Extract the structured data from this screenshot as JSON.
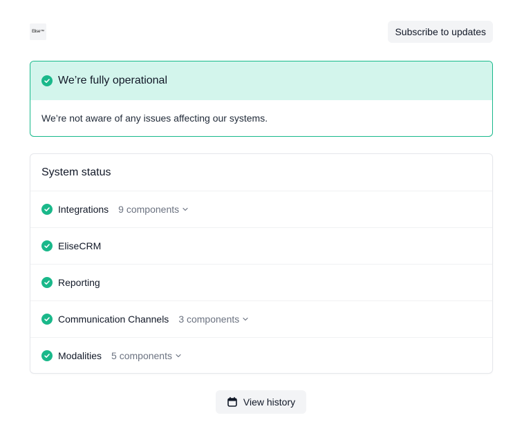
{
  "header": {
    "logo_text": "Elise™",
    "subscribe_label": "Subscribe to updates"
  },
  "banner": {
    "icon": "check-circle-icon",
    "title": "We’re fully operational",
    "message": "We’re not aware of any issues affecting our systems.",
    "accent_color": "#16b88a",
    "background_color": "#d3f5ec"
  },
  "system_status": {
    "title": "System status",
    "status_color": "#1ab88a",
    "components": [
      {
        "name": "Integrations",
        "count_label": "9 components",
        "expandable": true
      },
      {
        "name": "EliseCRM",
        "count_label": "",
        "expandable": false
      },
      {
        "name": "Reporting",
        "count_label": "",
        "expandable": false
      },
      {
        "name": "Communication Channels",
        "count_label": "3 components",
        "expandable": true
      },
      {
        "name": "Modalities",
        "count_label": "5 components",
        "expandable": true
      }
    ]
  },
  "footer": {
    "history_icon": "calendar-icon",
    "history_label": "View history"
  }
}
